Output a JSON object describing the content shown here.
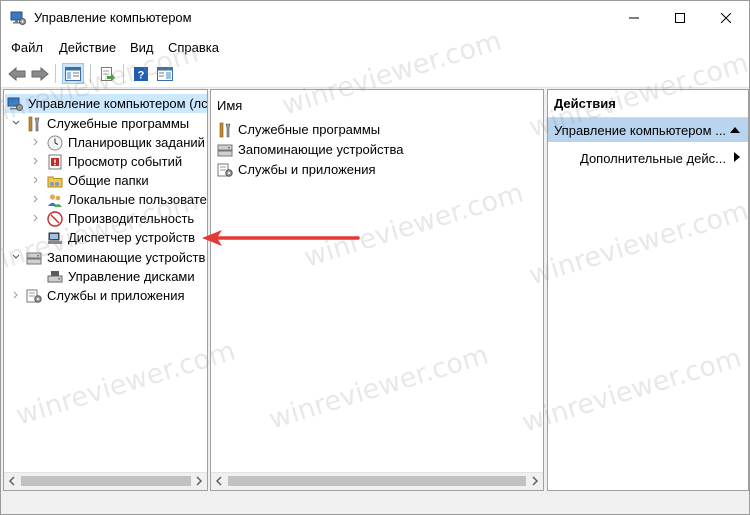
{
  "window": {
    "title": "Управление компьютером"
  },
  "menu": {
    "items": [
      "Файл",
      "Действие",
      "Вид",
      "Справка"
    ]
  },
  "tree": {
    "root": "Управление компьютером (лс",
    "system_tools": "Служебные программы",
    "task_scheduler": "Планировщик заданий",
    "event_viewer": "Просмотр событий",
    "shared_folders": "Общие папки",
    "local_users": "Локальные пользовате",
    "performance": "Производительность",
    "device_manager": "Диспетчер устройств",
    "storage": "Запоминающие устройств",
    "disk_management": "Управление дисками",
    "services_apps": "Службы и приложения"
  },
  "list": {
    "column_name": "Имя",
    "items": [
      "Служебные программы",
      "Запоминающие устройства",
      "Службы и приложения"
    ]
  },
  "actions": {
    "header": "Действия",
    "selected": "Управление компьютером ...",
    "more": "Дополнительные дейс..."
  },
  "watermark": "winreviewer.com",
  "colors": {
    "selection": "#cce8ff",
    "actions_selected": "#b8d4ef",
    "arrow": "#e53935"
  }
}
